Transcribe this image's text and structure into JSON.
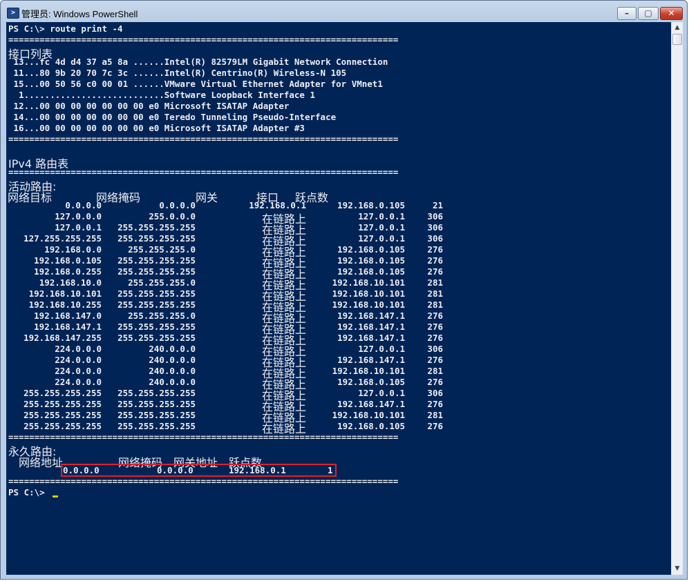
{
  "window": {
    "title": "管理员: Windows PowerShell",
    "controls": {
      "minimize": "–",
      "maximize": "▢",
      "close": "✕"
    }
  },
  "console": {
    "prompt_cmd": "PS C:\\> route print -4",
    "separator": "===========================================================================",
    "iface_heading": "接口列表",
    "interfaces": [
      " 13...fc 4d d4 37 a5 8a ......Intel(R) 82579LM Gigabit Network Connection",
      " 11...80 9b 20 70 7c 3c ......Intel(R) Centrino(R) Wireless-N 105",
      " 15...00 50 56 c0 00 01 ......VMware Virtual Ethernet Adapter for VMnet1",
      "  1...........................Software Loopback Interface 1",
      " 12...00 00 00 00 00 00 00 e0 Microsoft ISATAP Adapter",
      " 14...00 00 00 00 00 00 00 e0 Teredo Tunneling Pseudo-Interface",
      " 16...00 00 00 00 00 00 00 e0 Microsoft ISATAP Adapter #3"
    ],
    "ipv4_heading": "IPv4 路由表",
    "active_heading": "活动路由:",
    "active_columns": [
      "网络目标",
      "网络掩码",
      "网关",
      "接口",
      "跃点数"
    ],
    "active_routes": [
      [
        "0.0.0.0",
        "0.0.0.0",
        "192.168.0.1",
        "192.168.0.105",
        "21"
      ],
      [
        "127.0.0.0",
        "255.0.0.0",
        "在链路上",
        "127.0.0.1",
        "306"
      ],
      [
        "127.0.0.1",
        "255.255.255.255",
        "在链路上",
        "127.0.0.1",
        "306"
      ],
      [
        "127.255.255.255",
        "255.255.255.255",
        "在链路上",
        "127.0.0.1",
        "306"
      ],
      [
        "192.168.0.0",
        "255.255.255.0",
        "在链路上",
        "192.168.0.105",
        "276"
      ],
      [
        "192.168.0.105",
        "255.255.255.255",
        "在链路上",
        "192.168.0.105",
        "276"
      ],
      [
        "192.168.0.255",
        "255.255.255.255",
        "在链路上",
        "192.168.0.105",
        "276"
      ],
      [
        "192.168.10.0",
        "255.255.255.0",
        "在链路上",
        "192.168.10.101",
        "281"
      ],
      [
        "192.168.10.101",
        "255.255.255.255",
        "在链路上",
        "192.168.10.101",
        "281"
      ],
      [
        "192.168.10.255",
        "255.255.255.255",
        "在链路上",
        "192.168.10.101",
        "281"
      ],
      [
        "192.168.147.0",
        "255.255.255.0",
        "在链路上",
        "192.168.147.1",
        "276"
      ],
      [
        "192.168.147.1",
        "255.255.255.255",
        "在链路上",
        "192.168.147.1",
        "276"
      ],
      [
        "192.168.147.255",
        "255.255.255.255",
        "在链路上",
        "192.168.147.1",
        "276"
      ],
      [
        "224.0.0.0",
        "240.0.0.0",
        "在链路上",
        "127.0.0.1",
        "306"
      ],
      [
        "224.0.0.0",
        "240.0.0.0",
        "在链路上",
        "192.168.147.1",
        "276"
      ],
      [
        "224.0.0.0",
        "240.0.0.0",
        "在链路上",
        "192.168.10.101",
        "281"
      ],
      [
        "224.0.0.0",
        "240.0.0.0",
        "在链路上",
        "192.168.0.105",
        "276"
      ],
      [
        "255.255.255.255",
        "255.255.255.255",
        "在链路上",
        "127.0.0.1",
        "306"
      ],
      [
        "255.255.255.255",
        "255.255.255.255",
        "在链路上",
        "192.168.147.1",
        "276"
      ],
      [
        "255.255.255.255",
        "255.255.255.255",
        "在链路上",
        "192.168.10.101",
        "281"
      ],
      [
        "255.255.255.255",
        "255.255.255.255",
        "在链路上",
        "192.168.0.105",
        "276"
      ]
    ],
    "persistent_heading": "永久路由:",
    "persistent_columns": [
      "网络地址",
      "网络掩码",
      "网关地址",
      "跃点数"
    ],
    "persistent_route": [
      "0.0.0.0",
      "0.0.0.0",
      "192.168.0.1",
      "1"
    ],
    "final_prompt": "PS C:\\> "
  },
  "colors": {
    "console_bg": "#012456",
    "console_fg": "#eeedf0",
    "highlight": "#e3202a",
    "cursor": "#d0d000"
  }
}
